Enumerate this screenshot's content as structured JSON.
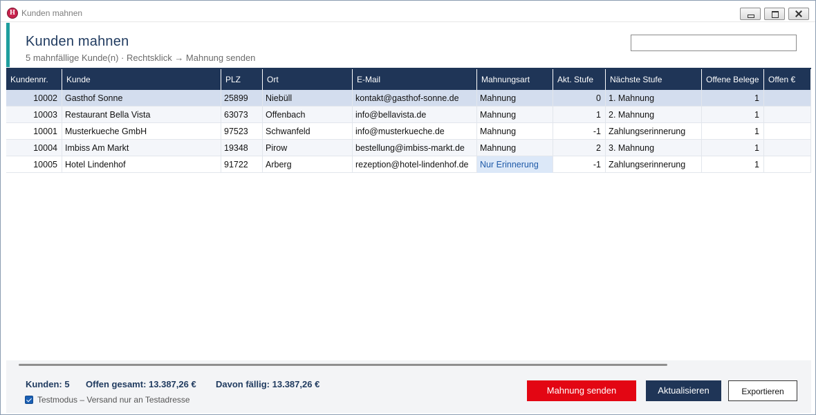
{
  "window": {
    "title": "Kunden mahnen"
  },
  "header": {
    "title": "Kunden mahnen",
    "subtitle": "5 mahnfällige Kunde(n)  ·  Rechtsklick → Mahnung senden",
    "search_value": ""
  },
  "table": {
    "columns": [
      "Kundennr.",
      "Kunde",
      "PLZ",
      "Ort",
      "E-Mail",
      "Mahnungsart",
      "Akt. Stufe",
      "Nächste Stufe",
      "Offene Belege",
      "Offen €"
    ],
    "rows": [
      [
        "10002",
        "Gasthof Sonne",
        "25899",
        "Niebüll",
        "kontakt@gasthof-sonne.de",
        "Mahnung",
        "0",
        "1. Mahnung",
        "1",
        ""
      ],
      [
        "10003",
        "Restaurant Bella Vista",
        "63073",
        "Offenbach",
        "info@bellavista.de",
        "Mahnung",
        "1",
        "2. Mahnung",
        "1",
        ""
      ],
      [
        "10001",
        "Musterkueche GmbH",
        "97523",
        "Schwanfeld",
        "info@musterkueche.de",
        "Mahnung",
        "-1",
        "Zahlungserinnerung",
        "1",
        ""
      ],
      [
        "10004",
        "Imbiss Am Markt",
        "19348",
        "Pirow",
        "bestellung@imbiss-markt.de",
        "Mahnung",
        "2",
        "3. Mahnung",
        "1",
        ""
      ],
      [
        "10005",
        "Hotel Lindenhof",
        "91722",
        "Arberg",
        "rezeption@hotel-lindenhof.de",
        "Nur Erinnerung",
        "-1",
        "Zahlungserinnerung",
        "1",
        ""
      ]
    ]
  },
  "footer": {
    "customers": "Kunden: 5",
    "open_total": "Offen gesamt: 13.387,26 €",
    "due_total": "Davon fällig: 13.387,26 €",
    "testmode_label": "Testmodus – Versand nur an Testadresse",
    "testmode_checked": true,
    "send_label": "Mahnung senden",
    "refresh_label": "Aktualisieren",
    "export_label": "Exportieren"
  },
  "colors": {
    "accent": "#1e9e9e",
    "header_bg": "#1f3557",
    "send_button": "#e30613",
    "title_text": "#1f3a5f"
  },
  "icons": {
    "app": "app-logo-icon",
    "minimize": "minimize-icon",
    "maximize": "maximize-icon",
    "close": "close-icon",
    "checkbox": "checkbox-checked-icon"
  }
}
